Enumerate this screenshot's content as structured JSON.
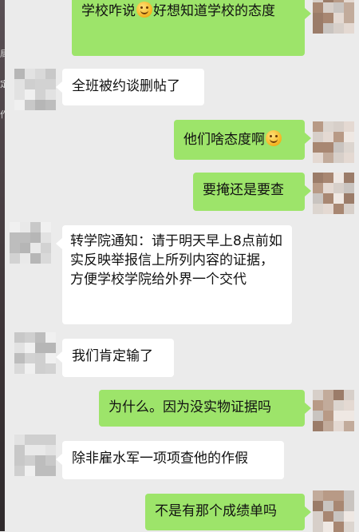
{
  "messages": [
    {
      "side": "me",
      "segments": [
        "学校咋说",
        "emoji:smile",
        "好想知道学校的态度"
      ]
    },
    {
      "side": "them",
      "segments": [
        "全班被约谈删帖了"
      ]
    },
    {
      "side": "me",
      "segments": [
        "他们啥态度啊",
        "emoji:smile"
      ]
    },
    {
      "side": "me",
      "segments": [
        "要掩还是要查"
      ]
    },
    {
      "side": "them",
      "segments": [
        "转学院通知：请于明天早上8点前如实反映举报信上所列内容的证据，方便学校学院给外界一个交代"
      ]
    },
    {
      "side": "them",
      "segments": [
        "我们肯定输了"
      ]
    },
    {
      "side": "me",
      "segments": [
        "为什么。因为没实物证据吗"
      ]
    },
    {
      "side": "them",
      "segments": [
        "除非雇水军一项项查他的作假"
      ]
    },
    {
      "side": "me",
      "segments": [
        "不是有那个成绩单吗"
      ]
    }
  ],
  "edge_glyphs": [
    "局",
    "定",
    "作"
  ],
  "colors": {
    "background": "#ebebeb",
    "my_bubble": "#9de46a",
    "their_bubble": "#ffffff",
    "edge_strip": "#3e3538"
  },
  "icons": {
    "emoji": "smiling-face-emoji"
  }
}
